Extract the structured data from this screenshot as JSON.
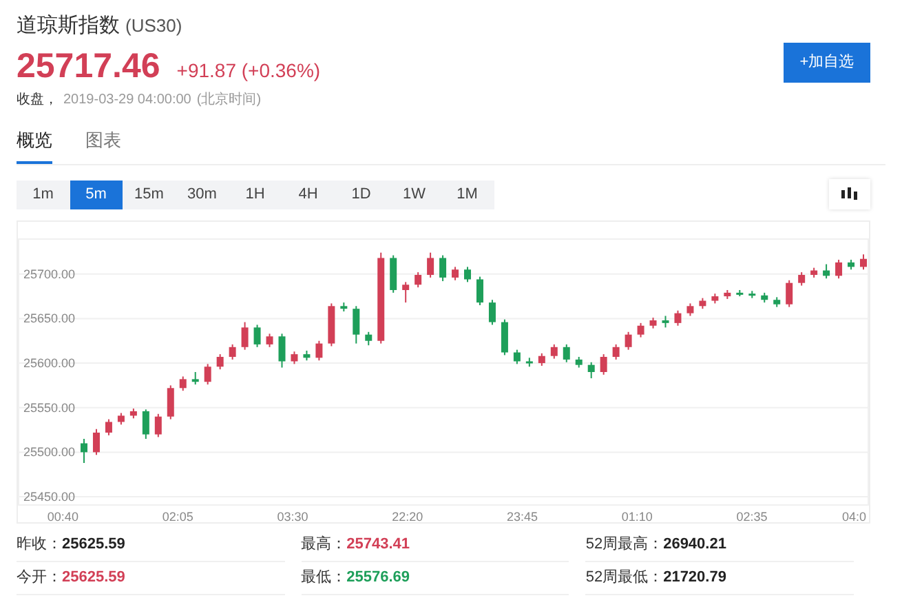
{
  "instrument": {
    "name": "道琼斯指数",
    "code": "(US30)"
  },
  "quote": {
    "price": "25717.46",
    "change": "+91.87 (+0.36%)",
    "color": "#d23f56"
  },
  "close": {
    "label": "收盘，",
    "time": "2019-03-29 04:00:00",
    "timezone": "(北京时间)"
  },
  "watchlist_button": "+加自选",
  "tabs": [
    {
      "label": "概览",
      "selected": true
    },
    {
      "label": "图表",
      "selected": false
    }
  ],
  "periods": [
    {
      "label": "1m",
      "selected": false
    },
    {
      "label": "5m",
      "selected": true
    },
    {
      "label": "15m",
      "selected": false
    },
    {
      "label": "30m",
      "selected": false
    },
    {
      "label": "1H",
      "selected": false
    },
    {
      "label": "4H",
      "selected": false
    },
    {
      "label": "1D",
      "selected": false
    },
    {
      "label": "1W",
      "selected": false
    },
    {
      "label": "1M",
      "selected": false
    }
  ],
  "chart": {
    "x_labels": [
      "00:40",
      "02:05",
      "03:30",
      "22:20",
      "23:45",
      "01:10",
      "02:35",
      "04:0"
    ],
    "chart_data": {
      "type": "candlestick",
      "ylim": [
        25440,
        25740
      ],
      "yticks": [
        {
          "value": 25700,
          "label": "25700.00"
        },
        {
          "value": 25650,
          "label": "25650.00"
        },
        {
          "value": 25600,
          "label": "25600.00"
        },
        {
          "value": 25550,
          "label": "25550.00"
        },
        {
          "value": 25500,
          "label": "25500.00"
        },
        {
          "value": 25450,
          "label": "25450.00"
        }
      ],
      "grid": true,
      "ohlc": [
        [
          25510,
          25515,
          25488,
          25500
        ],
        [
          25500,
          25526,
          25497,
          25522
        ],
        [
          25522,
          25537,
          25519,
          25534
        ],
        [
          25534,
          25544,
          25531,
          25541
        ],
        [
          25541,
          25549,
          25538,
          25546
        ],
        [
          25546,
          25548,
          25515,
          25520
        ],
        [
          25520,
          25543,
          25517,
          25540
        ],
        [
          25540,
          25575,
          25537,
          25572
        ],
        [
          25572,
          25585,
          25569,
          25582
        ],
        [
          25582,
          25590,
          25576,
          25579
        ],
        [
          25579,
          25599,
          25576,
          25596
        ],
        [
          25596,
          25610,
          25593,
          25607
        ],
        [
          25607,
          25621,
          25604,
          25618
        ],
        [
          25618,
          25646,
          25615,
          25640
        ],
        [
          25640,
          25643,
          25618,
          25621
        ],
        [
          25621,
          25633,
          25618,
          25630
        ],
        [
          25630,
          25633,
          25595,
          25602
        ],
        [
          25602,
          25613,
          25599,
          25610
        ],
        [
          25610,
          25614,
          25603,
          25606
        ],
        [
          25606,
          25625,
          25603,
          25622
        ],
        [
          25622,
          25667,
          25619,
          25664
        ],
        [
          25664,
          25668,
          25658,
          25661
        ],
        [
          25661,
          25664,
          25622,
          25632
        ],
        [
          25632,
          25635,
          25620,
          25625
        ],
        [
          25625,
          25724,
          25622,
          25718
        ],
        [
          25718,
          25721,
          25679,
          25682
        ],
        [
          25682,
          25691,
          25668,
          25688
        ],
        [
          25688,
          25702,
          25685,
          25699
        ],
        [
          25699,
          25724,
          25696,
          25718
        ],
        [
          25718,
          25721,
          25692,
          25696
        ],
        [
          25696,
          25708,
          25693,
          25705
        ],
        [
          25705,
          25708,
          25691,
          25694
        ],
        [
          25694,
          25697,
          25665,
          25668
        ],
        [
          25668,
          25671,
          25643,
          25646
        ],
        [
          25646,
          25649,
          25609,
          25612
        ],
        [
          25612,
          25615,
          25599,
          25602
        ],
        [
          25602,
          25606,
          25596,
          25600
        ],
        [
          25600,
          25611,
          25597,
          25608
        ],
        [
          25608,
          25621,
          25605,
          25618
        ],
        [
          25618,
          25621,
          25601,
          25604
        ],
        [
          25604,
          25607,
          25595,
          25598
        ],
        [
          25598,
          25601,
          25583,
          25590
        ],
        [
          25590,
          25610,
          25587,
          25607
        ],
        [
          25607,
          25621,
          25604,
          25618
        ],
        [
          25618,
          25635,
          25615,
          25632
        ],
        [
          25632,
          25645,
          25629,
          25642
        ],
        [
          25642,
          25651,
          25639,
          25648
        ],
        [
          25648,
          25653,
          25640,
          25645
        ],
        [
          25645,
          25659,
          25642,
          25656
        ],
        [
          25656,
          25667,
          25653,
          25664
        ],
        [
          25664,
          25673,
          25661,
          25670
        ],
        [
          25670,
          25678,
          25667,
          25675
        ],
        [
          25675,
          25682,
          25672,
          25679
        ],
        [
          25679,
          25682,
          25675,
          25678
        ],
        [
          25678,
          25681,
          25673,
          25676
        ],
        [
          25676,
          25679,
          25668,
          25671
        ],
        [
          25671,
          25674,
          25663,
          25666
        ],
        [
          25666,
          25693,
          25663,
          25690
        ],
        [
          25690,
          25702,
          25687,
          25699
        ],
        [
          25699,
          25707,
          25696,
          25704
        ],
        [
          25704,
          25711,
          25695,
          25698
        ],
        [
          25698,
          25716,
          25695,
          25713
        ],
        [
          25713,
          25716,
          25705,
          25708
        ],
        [
          25708,
          25722,
          25705,
          25717
        ]
      ]
    }
  },
  "stats": [
    {
      "label": "昨收：",
      "value": "25625.59",
      "color": "#222222"
    },
    {
      "label": "最高：",
      "value": "25743.41",
      "color": "#d23f56"
    },
    {
      "label": "52周最高：",
      "value": "26940.21",
      "color": "#222222"
    },
    {
      "label": "今开：",
      "value": "25625.59",
      "color": "#d23f56"
    },
    {
      "label": "最低：",
      "value": "25576.69",
      "color": "#1e9f5a"
    },
    {
      "label": "52周最低：",
      "value": "21720.79",
      "color": "#222222"
    }
  ]
}
